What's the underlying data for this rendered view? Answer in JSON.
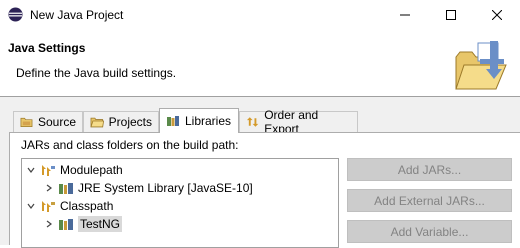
{
  "window": {
    "title": "New Java Project",
    "controls": {
      "minimize": "minimize-icon",
      "maximize": "maximize-icon",
      "close": "close-icon"
    }
  },
  "header": {
    "title": "Java Settings",
    "description": "Define the Java build settings."
  },
  "tabs": [
    {
      "label": "Source",
      "icon": "source-folder-icon",
      "active": false
    },
    {
      "label": "Projects",
      "icon": "projects-icon",
      "active": false
    },
    {
      "label": "Libraries",
      "icon": "libraries-icon",
      "active": true
    },
    {
      "label": "Order and Export",
      "icon": "order-export-icon",
      "active": false
    }
  ],
  "libraries": {
    "label": "JARs and class folders on the build path:",
    "tree": [
      {
        "label": "Modulepath",
        "expanded": true,
        "level": 0
      },
      {
        "label": "JRE System Library [JavaSE-10]",
        "expanded": false,
        "level": 1
      },
      {
        "label": "Classpath",
        "expanded": true,
        "level": 0
      },
      {
        "label": "TestNG",
        "expanded": false,
        "level": 1,
        "selected": true
      }
    ],
    "buttons": [
      {
        "label": "Add JARs...",
        "enabled": false
      },
      {
        "label": "Add External JARs...",
        "enabled": false
      },
      {
        "label": "Add Variable...",
        "enabled": false
      }
    ]
  },
  "colors": {
    "accent": "#6b8fc7",
    "disabled_button": "#cccccc",
    "disabled_text": "#838383"
  }
}
